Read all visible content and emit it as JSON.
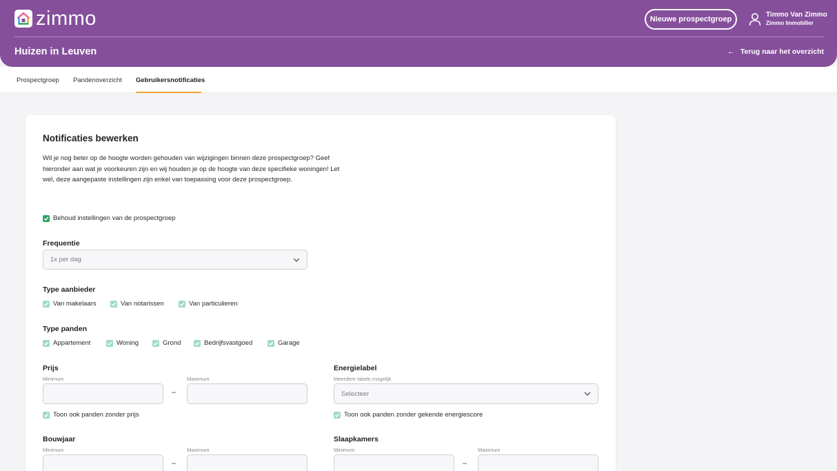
{
  "header": {
    "logo_text": "zimmo",
    "new_button": "Nieuwe prospectgroep",
    "user_name": "Timmo Van Zimmo",
    "user_company": "Zimmo Immobilier",
    "page_title": "Huizen in Leuven",
    "back_link": "Terug naar het overzicht"
  },
  "tabs": [
    {
      "label": "Prospectgroep"
    },
    {
      "label": "Pandenoverzicht"
    },
    {
      "label": "Gebruikersnotificaties"
    }
  ],
  "form": {
    "title": "Notificaties bewerken",
    "intro": "Wil je nog beter op de hoogte worden gehouden van wijzigingen binnen deze prospectgroep? Geef hieronder aan wat je voorkeuren zijn en wij houden je op de hoogte van deze specifieke woningen! Let wel, deze aangepaste instellingen zijn enkel van toepassing voor deze prospectgroep.",
    "keep_settings": "Behoud instellingen van de prospectgroep",
    "frequency_label": "Frequentie",
    "frequency_value": "1x per dag",
    "provider_label": "Type aanbieder",
    "providers": [
      "Van makelaars",
      "Van notarissen",
      "Van particulieren"
    ],
    "property_label": "Type panden",
    "property_types": [
      "Appartement",
      "Woning",
      "Grond",
      "Bedrijfsvastgoed",
      "Garage"
    ],
    "price_label": "Prijs",
    "min_label": "Minimum",
    "max_label": "Maximum",
    "dash": "–",
    "price_no_price": "Toon ook panden zonder prijs",
    "energy_label": "Energielabel",
    "energy_sub": "Meerdere labels mogelijk",
    "energy_placeholder": "Selecteer",
    "energy_no_score": "Toon ook panden zonder gekende energiescore",
    "year_label": "Bouwjaar",
    "bedrooms_label": "Slaapkamers"
  },
  "colors": {
    "header": "#854f9b",
    "accent": "#f3a433",
    "check_dark": "#2fa566",
    "check_light": "#9fdcc0"
  }
}
